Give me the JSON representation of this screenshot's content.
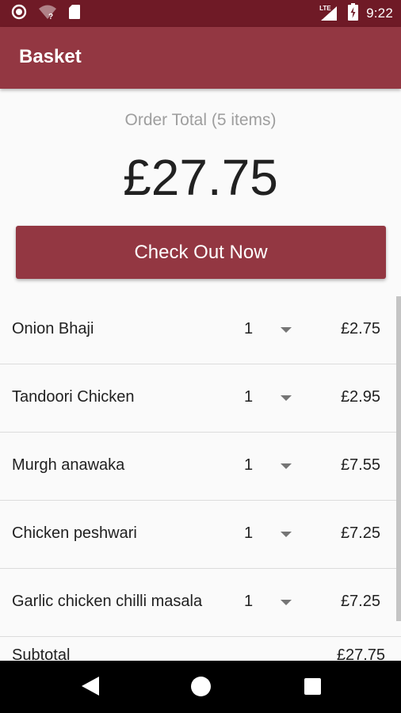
{
  "status_bar": {
    "time": "9:22",
    "network_label": "LTE",
    "icons": [
      "circle-notification-icon",
      "wifi-unknown-icon",
      "sd-card-icon",
      "cell-signal-icon",
      "battery-charging-icon"
    ]
  },
  "app_bar": {
    "title": "Basket"
  },
  "order": {
    "total_label": "Order Total (5 items)",
    "total_value": "£27.75",
    "checkout_label": "Check Out Now"
  },
  "items": [
    {
      "name": "Onion Bhaji",
      "quantity": "1",
      "price": "£2.75"
    },
    {
      "name": "Tandoori Chicken",
      "quantity": "1",
      "price": "£2.95"
    },
    {
      "name": "Murgh anawaka",
      "quantity": "1",
      "price": "£7.55"
    },
    {
      "name": "Chicken peshwari",
      "quantity": "1",
      "price": "£7.25"
    },
    {
      "name": "Garlic chicken chilli masala",
      "quantity": "1",
      "price": "£7.25"
    }
  ],
  "subtotal": {
    "label": "Subtotal",
    "value": "£27.75"
  },
  "colors": {
    "status_bar": "#6f1a26",
    "app_bar": "#933742",
    "button": "#933742"
  },
  "nav_bar": {
    "icons": [
      "back-icon",
      "home-icon",
      "recents-icon"
    ]
  }
}
